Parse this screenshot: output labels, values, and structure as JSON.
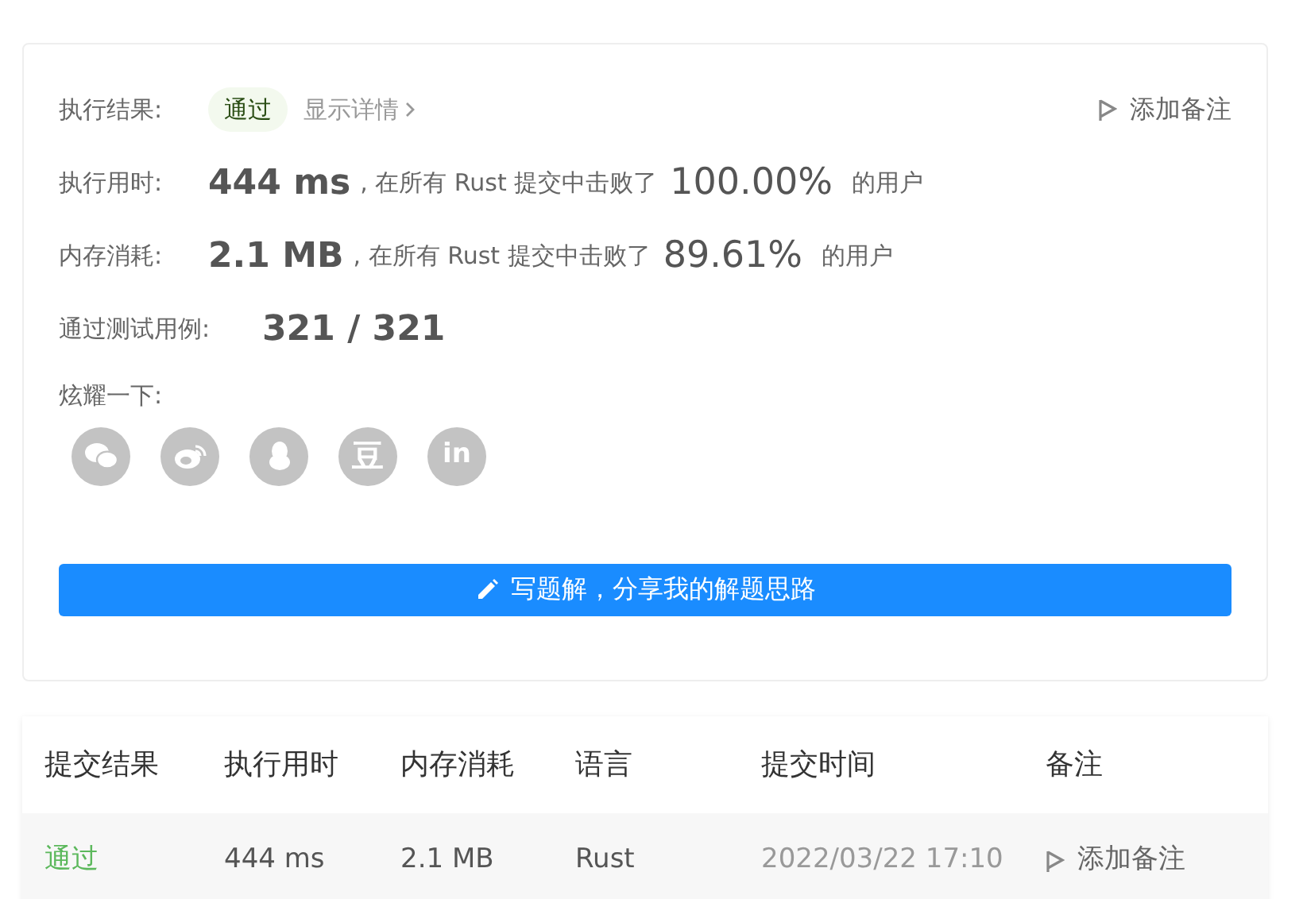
{
  "result": {
    "label": "执行结果:",
    "status": "通过",
    "details_link": "显示详情",
    "note_button": "添加备注"
  },
  "stats": [
    {
      "label": "执行用时:",
      "value": "444 ms",
      "middle": ", 在所有 Rust 提交中击败了",
      "percent": "100.00%",
      "suffix": "的用户"
    },
    {
      "label": "内存消耗:",
      "value": "2.1 MB",
      "middle": ", 在所有 Rust 提交中击败了",
      "percent": "89.61%",
      "suffix": "的用户"
    }
  ],
  "tests": {
    "label": "通过测试用例:",
    "value": "321 / 321"
  },
  "share": {
    "label": "炫耀一下:",
    "icons": [
      {
        "kind": "wechat"
      },
      {
        "kind": "weibo"
      },
      {
        "kind": "qq"
      },
      {
        "kind": "douban",
        "glyph": "豆"
      },
      {
        "kind": "linkedin",
        "glyph": "in"
      }
    ]
  },
  "solution_button": "写题解，分享我的解题思路",
  "table": {
    "columns": [
      "提交结果",
      "执行用时",
      "内存消耗",
      "语言",
      "提交时间",
      "备注"
    ],
    "rows": [
      {
        "status": "通过",
        "color": "#5cb85c",
        "runtime": "444 ms",
        "memory": "2.1 MB",
        "language": "Rust",
        "time": "2022/03/22 17:10",
        "note": "添加备注"
      }
    ]
  }
}
